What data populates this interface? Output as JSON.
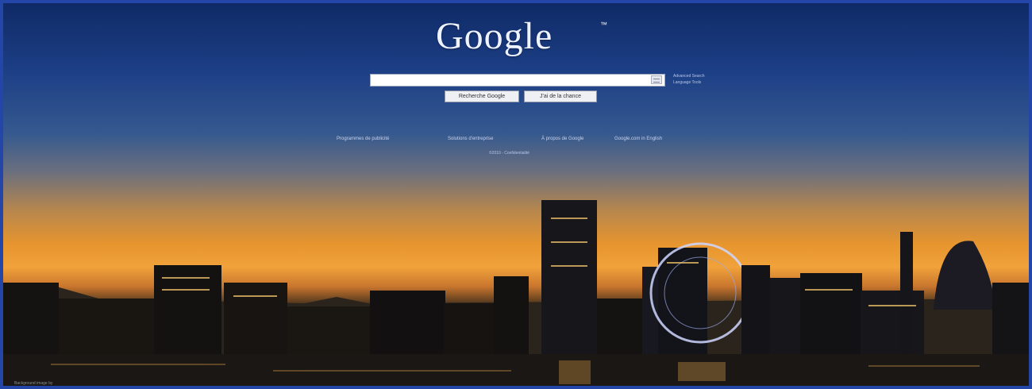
{
  "logo": {
    "text": "Google",
    "tm": "™"
  },
  "search": {
    "value": "",
    "placeholder": ""
  },
  "side_links": {
    "advanced": "Advanced Search",
    "language": "Language Tools"
  },
  "buttons": {
    "search": "Recherche Google",
    "lucky": "J'ai de la chance"
  },
  "footer_links": [
    "Programmes de publicité",
    "Solutions d'entreprise",
    "À propos de Google",
    "Google.com in English"
  ],
  "copyright": "©2010 - Confidentialité",
  "bottom_credit": "Background image by",
  "colors": {
    "frame": "#2446a8",
    "sky_top": "#0f2a66",
    "sunset": "#f1a23a"
  }
}
